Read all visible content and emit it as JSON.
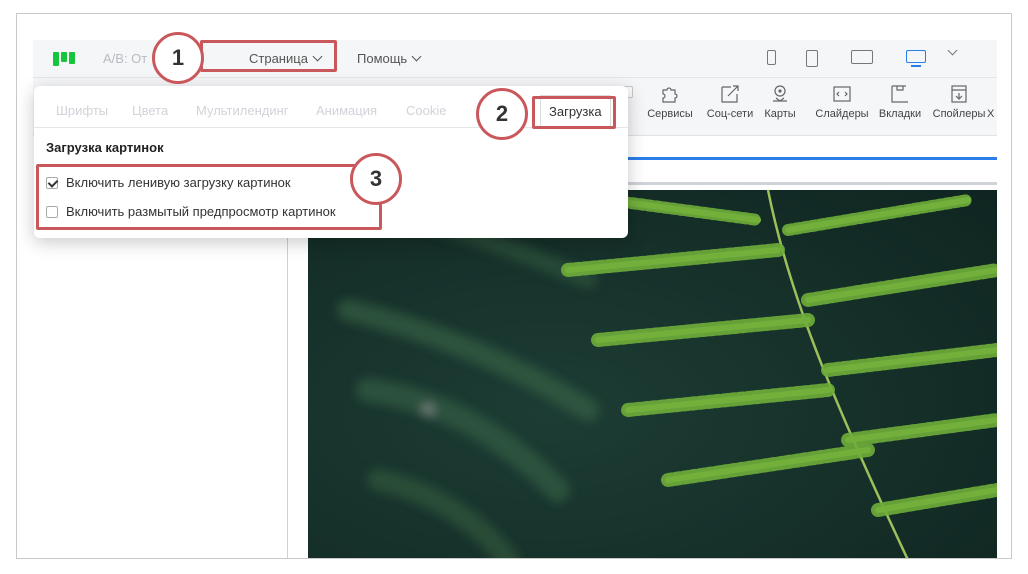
{
  "menubar": {
    "ab_label": "A/B: От",
    "page_label": "Страница",
    "help_label": "Помощь"
  },
  "toolbar": {
    "tools": [
      {
        "label": "Сервисы",
        "icon": "puzzle-icon"
      },
      {
        "label": "Соц-сети",
        "icon": "share-icon"
      },
      {
        "label": "Карты",
        "icon": "map-pin-icon"
      },
      {
        "label": "Слайдеры",
        "icon": "slider-icon"
      },
      {
        "label": "Вкладки",
        "icon": "tabs-icon"
      },
      {
        "label": "Спойлеры",
        "icon": "spoiler-icon"
      },
      {
        "label": "Х",
        "icon": ""
      }
    ]
  },
  "panel": {
    "tabs": [
      "Шрифты",
      "Цвета",
      "Мультилендинг",
      "Анимация",
      "Cookie",
      "Загрузка"
    ],
    "active_tab": "Загрузка",
    "section_title": "Загрузка картинок",
    "options": [
      {
        "label": "Включить ленивую загрузку картинок",
        "checked": true
      },
      {
        "label": "Включить размытый предпросмотр картинок",
        "checked": false
      }
    ]
  },
  "annotations": [
    "1",
    "2",
    "3"
  ],
  "colors": {
    "accent": "#2b7de9",
    "brand": "#15c53c",
    "annotation": "#c9585c"
  }
}
